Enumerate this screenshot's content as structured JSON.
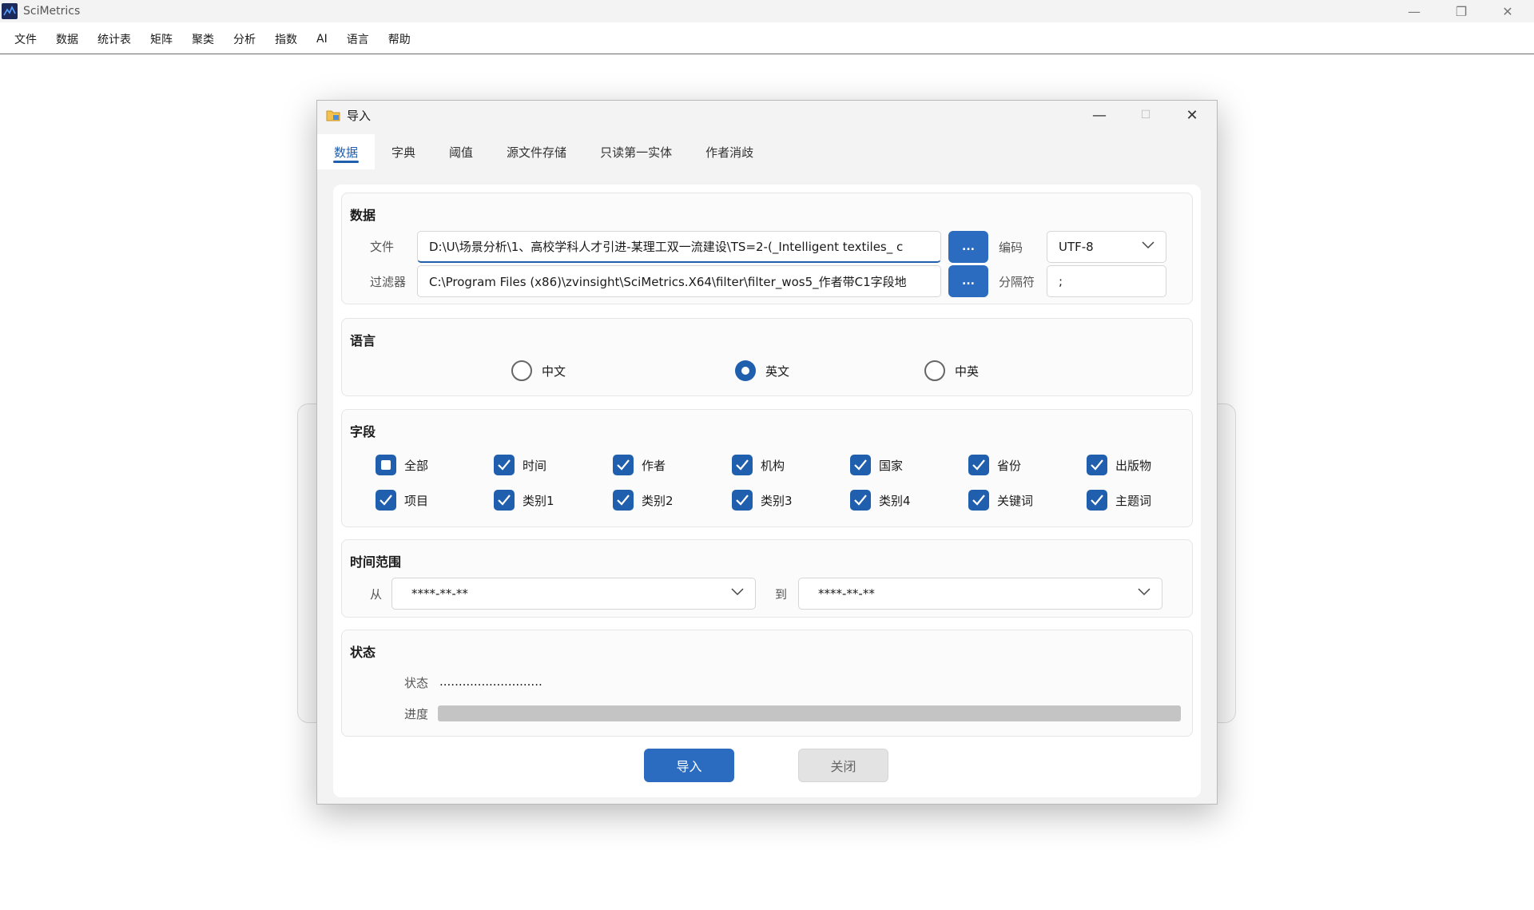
{
  "app": {
    "title": "SciMetrics"
  },
  "menu": [
    "文件",
    "数据",
    "统计表",
    "矩阵",
    "聚类",
    "分析",
    "指数",
    "AI",
    "语言",
    "帮助"
  ],
  "dialog": {
    "title": "导入",
    "tabs": [
      "数据",
      "字典",
      "阈值",
      "源文件存储",
      "只读第一实体",
      "作者消歧"
    ],
    "active_tab": "数据",
    "data_group": {
      "title": "数据",
      "file_label": "文件",
      "file_value": "D:\\U\\场景分析\\1、高校学科人才引进-某理工双一流建设\\TS=2-(_Intelligent textiles_ c",
      "filter_label": "过滤器",
      "filter_value": "C:\\Program Files (x86)\\zvinsight\\SciMetrics.X64\\filter\\filter_wos5_作者带C1字段地",
      "browse_label": "...",
      "encoding_label": "编码",
      "encoding_value": "UTF-8",
      "separator_label": "分隔符",
      "separator_value": ";"
    },
    "language_group": {
      "title": "语言",
      "options": [
        "中文",
        "英文",
        "中英"
      ],
      "selected": "英文"
    },
    "fields_group": {
      "title": "字段",
      "row1": [
        "全部",
        "时间",
        "作者",
        "机构",
        "国家",
        "省份",
        "出版物"
      ],
      "row2": [
        "项目",
        "类别1",
        "类别2",
        "类别3",
        "类别4",
        "关键词",
        "主题词"
      ]
    },
    "time_group": {
      "title": "时间范围",
      "from_label": "从",
      "from_value": "****-**-**",
      "to_label": "到",
      "to_value": "****-**-**"
    },
    "status_group": {
      "title": "状态",
      "status_label": "状态",
      "status_value": "...........................",
      "progress_label": "进度",
      "progress": 0
    },
    "buttons": {
      "import": "导入",
      "close": "关闭"
    }
  },
  "colors": {
    "accent": "#2c6cc0",
    "tab_active": "#1f5fad"
  }
}
